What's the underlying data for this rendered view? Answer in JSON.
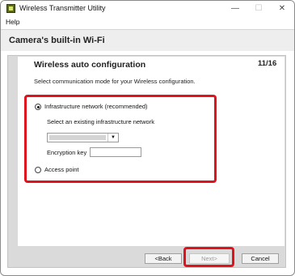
{
  "window": {
    "title": "Wireless Transmitter Utility",
    "controls": {
      "minimize": "—",
      "maximize": "☐",
      "close": "✕"
    }
  },
  "menu": {
    "items": [
      "Help"
    ]
  },
  "header": {
    "title": "Camera's built-in Wi-Fi"
  },
  "content": {
    "section_title": "Wireless auto configuration",
    "page_counter": "11/16",
    "subtitle": "Select communication mode for your Wireless configuration.",
    "options": {
      "infrastructure": {
        "label": "Infrastructure network (recommended)",
        "selected": true
      },
      "access_point": {
        "label": "Access point",
        "selected": false
      }
    },
    "network_select_label": "Select an existing infrastructure network",
    "network_combo_value": "",
    "encryption_key_label": "Encryption key",
    "encryption_key_value": ""
  },
  "buttons": {
    "back": "<Back",
    "next": "Next>",
    "cancel": "Cancel"
  },
  "colors": {
    "highlight": "#e0121b",
    "header_bg": "#eeeeee",
    "panel_frame_bg": "#dadada"
  },
  "icons": {
    "app": "wireless-transmitter-app-icon",
    "dropdown": "chevron-down-icon"
  }
}
